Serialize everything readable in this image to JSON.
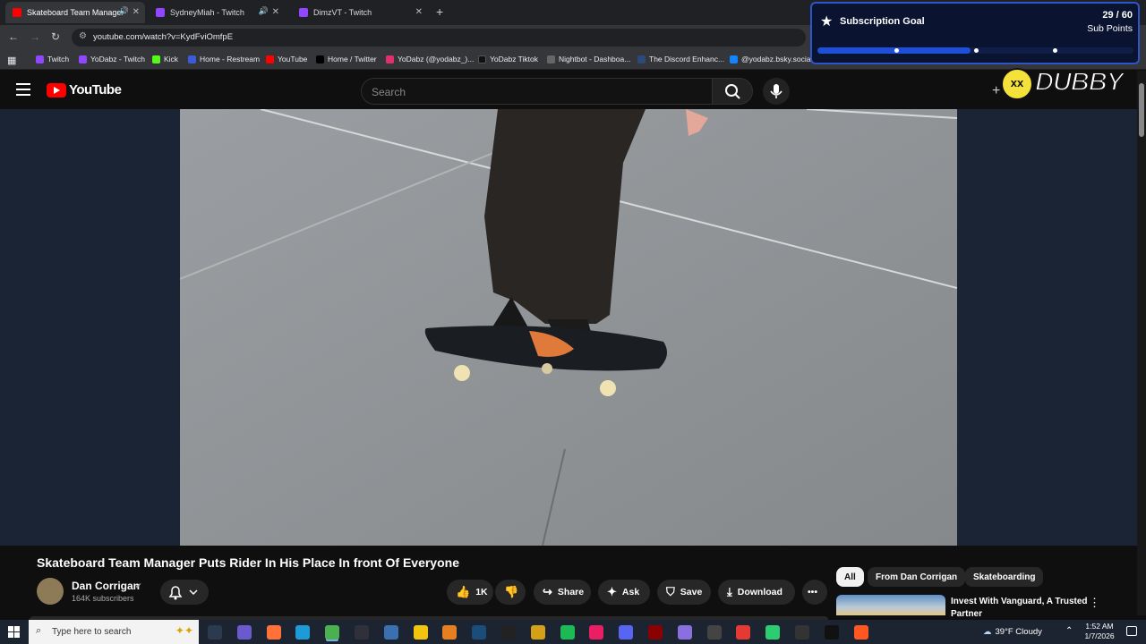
{
  "browser": {
    "tabs": [
      {
        "title": "Skateboard Team Manager",
        "active": true,
        "audio": true,
        "favicon_color": "#ff0000"
      },
      {
        "title": "SydneyMiah - Twitch",
        "active": false,
        "audio": true,
        "favicon_color": "#9146ff"
      },
      {
        "title": "DimzVT - Twitch",
        "active": false,
        "audio": false,
        "favicon_color": "#9146ff"
      }
    ],
    "new_tab_glyph": "+",
    "close_glyph": "✕",
    "url": "youtube.com/watch?v=KydFviOmfpE",
    "bookmarks": [
      {
        "label": "Twitch",
        "color": "#9146ff"
      },
      {
        "label": "YoDabz - Twitch",
        "color": "#9146ff"
      },
      {
        "label": "Kick",
        "color": "#53fc18"
      },
      {
        "label": "Home - Restream",
        "color": "#3b5bdb"
      },
      {
        "label": "YouTube",
        "color": "#ff0000"
      },
      {
        "label": "Home / Twitter",
        "color": "#000000"
      },
      {
        "label": "YoDabz (@yodabz_)...",
        "color": "#e1306c"
      },
      {
        "label": "YoDabz Tiktok",
        "color": "#111111"
      },
      {
        "label": "Nightbot - Dashboa...",
        "color": "#666666"
      },
      {
        "label": "The Discord Enhanc...",
        "color": "#2b4a7a"
      },
      {
        "label": "@yodabz.bsky.socia...",
        "color": "#1185fe"
      }
    ]
  },
  "youtube": {
    "logo_text": "YouTube",
    "search_placeholder": "Search",
    "create_glyph": "+"
  },
  "overlay": {
    "goal_title": "Subscription Goal",
    "goal_current": 29,
    "goal_target": 60,
    "goal_count_text": "29 / 60",
    "goal_unit": "Sub Points",
    "goal_progress": 0.4833,
    "goal_markers": [
      0.25,
      0.5,
      0.75
    ],
    "brand_word": "DUBBY"
  },
  "video": {
    "title": "Skateboard Team Manager Puts Rider In His Place In front Of Everyone",
    "channel": "Dan Corrigan",
    "subscribers": "164K subscribers",
    "likes": "1K",
    "actions": {
      "share": "Share",
      "ask": "Ask",
      "save": "Save",
      "download": "Download"
    }
  },
  "sidebar": {
    "chips": [
      {
        "label": "All",
        "selected": true
      },
      {
        "label": "From Dan Corrigan",
        "selected": false
      },
      {
        "label": "Skateboarding",
        "selected": false
      }
    ],
    "ad_title": "Invest With Vanguard, A Trusted Partner"
  },
  "taskbar": {
    "search_placeholder": "Type here to search",
    "weather": "39°F  Cloudy",
    "time": "1:52 AM",
    "date": "1/7/2026",
    "apps": [
      {
        "name": "task-view",
        "color": "#2c3a50"
      },
      {
        "name": "copilot",
        "color": "#6a5acd"
      },
      {
        "name": "firefox",
        "color": "#ff7139"
      },
      {
        "name": "edge",
        "color": "#1e9bd7"
      },
      {
        "name": "chrome",
        "color": "#4caf50"
      },
      {
        "name": "obs",
        "color": "#30303a"
      },
      {
        "name": "app-spiral",
        "color": "#3a6fb0"
      },
      {
        "name": "file-explorer",
        "color": "#f1c40f"
      },
      {
        "name": "app-a",
        "color": "#e67e22"
      },
      {
        "name": "steam",
        "color": "#1b4d7a"
      },
      {
        "name": "epic",
        "color": "#222222"
      },
      {
        "name": "app-yellow",
        "color": "#d4a017"
      },
      {
        "name": "spotify",
        "color": "#1db954"
      },
      {
        "name": "app-red",
        "color": "#e91e63"
      },
      {
        "name": "discord",
        "color": "#5865f2"
      },
      {
        "name": "app-dark-red",
        "color": "#8b0000"
      },
      {
        "name": "app-feather",
        "color": "#8a6fdf"
      },
      {
        "name": "settings",
        "color": "#444444"
      },
      {
        "name": "app-aim",
        "color": "#e53935"
      },
      {
        "name": "app-green",
        "color": "#2ecc71"
      },
      {
        "name": "app-ring",
        "color": "#333333"
      },
      {
        "name": "tiktok",
        "color": "#111111"
      },
      {
        "name": "app-orange",
        "color": "#ff5722"
      }
    ]
  }
}
